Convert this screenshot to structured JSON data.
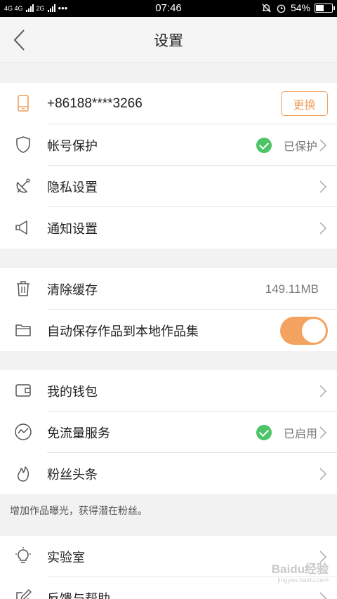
{
  "status_bar": {
    "network1": "4G 4G",
    "network2": "2G",
    "dots": "•••",
    "time": "07:46",
    "battery_percent": "54%",
    "battery_level": 0.54
  },
  "nav": {
    "title": "设置"
  },
  "account": {
    "phone": "+86188****3266",
    "change_label": "更换",
    "protect_label": "帐号保护",
    "protect_status": "已保护",
    "privacy_label": "隐私设置",
    "notify_label": "通知设置"
  },
  "storage": {
    "clear_cache_label": "清除缓存",
    "cache_size": "149.11MB",
    "autosave_label": "自动保存作品到本地作品集",
    "autosave_on": true
  },
  "services": {
    "wallet_label": "我的钱包",
    "free_data_label": "免流量服务",
    "free_data_status": "已启用",
    "fans_label": "粉丝头条",
    "fans_hint": "增加作品曝光，获得潜在粉丝。"
  },
  "more": {
    "lab_label": "实验室",
    "feedback_label": "反馈与帮助"
  },
  "watermark": {
    "logo": "Baidu经验",
    "url": "jingyan.baidu.com"
  },
  "colors": {
    "accent": "#f4a260",
    "check": "#4cc467",
    "page_bg": "#f2f2f2"
  }
}
